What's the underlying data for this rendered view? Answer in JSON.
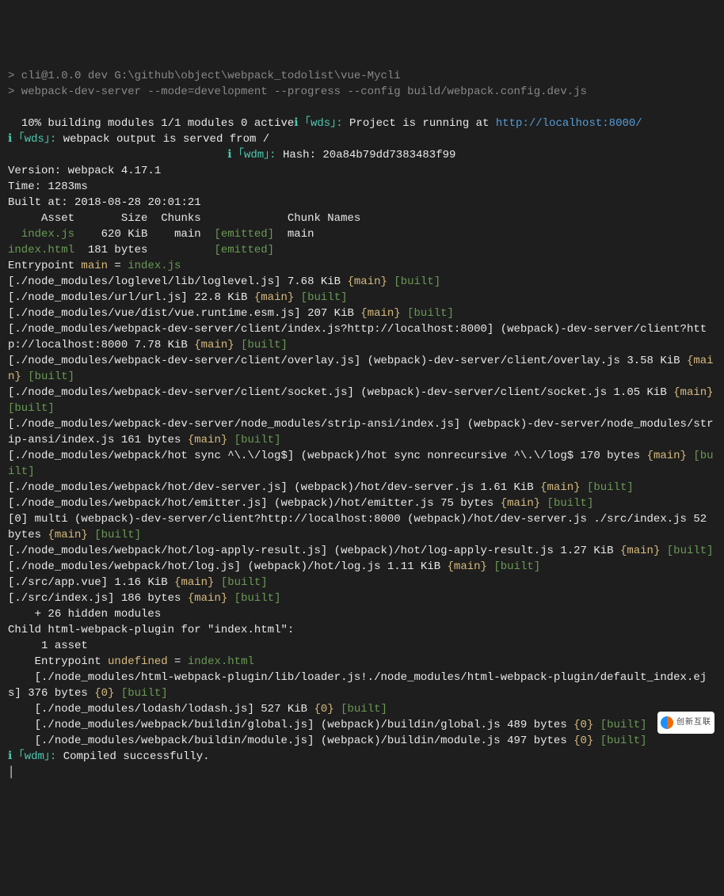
{
  "prompt1": "> cli@1.0.0 dev G:\\github\\object\\webpack_todolist\\vue-Mycli",
  "prompt2": "> webpack-dev-server --mode=development --progress --config build/webpack.config.dev.js",
  "progress": "  10% building modules 1/1 modules 0 active",
  "wds_tag": "ℹ ｢wds｣:",
  "running_at": " Project is running at ",
  "url": "http://localhost:8000/",
  "served_from": " webpack output is served from ",
  "slash": "/",
  "wdm_tag": "ℹ ｢wdm｣:",
  "hash": " Hash: 20a84b79dd7383483f99",
  "version_label": "Version:",
  "version_value": " webpack 4.17.1",
  "time_label": "Time:",
  "time_value": " 1283ms",
  "built_label": "Built at:",
  "built_value": " 2018-08-28 20:01:21",
  "header_row": "     Asset       Size  Chunks             Chunk Names",
  "row1_asset": "  index.js",
  "row1_size": "    620 KiB    ",
  "row1_chunk": "main",
  "row1_emit": "  [emitted]  ",
  "row1_name": "main",
  "row2_asset": "index.html",
  "row2_size": "  181 bytes          ",
  "row2_emit": "[emitted]",
  "entry_label": "Entrypoint ",
  "entry_main": "main",
  "entry_eq": " = ",
  "entry_file": "index.js",
  "lines": [
    {
      "p": "[./node_modules/loglevel/lib/loglevel.js]",
      "s": " 7.68 KiB ",
      "c": "{main}",
      "b": " [built]"
    },
    {
      "p": "[./node_modules/url/url.js]",
      "s": " 22.8 KiB ",
      "c": "{main}",
      "b": " [built]"
    },
    {
      "p": "[./node_modules/vue/dist/vue.runtime.esm.js]",
      "s": " 207 KiB ",
      "c": "{main}",
      "b": " [built]"
    },
    {
      "p": "[./node_modules/webpack-dev-server/client/index.js?http://localhost:8000]",
      "s": " (webpack)-dev-server/client?http://localhost:8000 7.78 KiB ",
      "c": "{main}",
      "b": " [built]"
    },
    {
      "p": "[./node_modules/webpack-dev-server/client/overlay.js]",
      "s": " (webpack)-dev-server/client/overlay.js 3.58 KiB ",
      "c": "{main}",
      "b": " [built]"
    },
    {
      "p": "[./node_modules/webpack-dev-server/client/socket.js]",
      "s": " (webpack)-dev-server/client/socket.js 1.05 KiB ",
      "c": "{main}",
      "b": " [built]"
    },
    {
      "p": "[./node_modules/webpack-dev-server/node_modules/strip-ansi/index.js]",
      "s": " (webpack)-dev-server/node_modules/strip-ansi/index.js 161 bytes ",
      "c": "{main}",
      "b": " [built]"
    },
    {
      "p": "[./node_modules/webpack/hot sync ^\\.\\/log$]",
      "s": " (webpack)/hot sync nonrecursive ^\\.\\/log$ 170 bytes ",
      "c": "{main}",
      "b": " [built]"
    },
    {
      "p": "[./node_modules/webpack/hot/dev-server.js]",
      "s": " (webpack)/hot/dev-server.js 1.61 KiB ",
      "c": "{main}",
      "b": " [built]"
    },
    {
      "p": "[./node_modules/webpack/hot/emitter.js]",
      "s": " (webpack)/hot/emitter.js 75 bytes ",
      "c": "{main}",
      "b": " [built]"
    },
    {
      "p": "[0] ",
      "pb": "multi (webpack)-dev-server/client?http://localhost:8000 (webpack)/hot/dev-server.js ./src/index.js",
      "s": " 52 bytes ",
      "c": "{main}",
      "b": " [built]"
    },
    {
      "p": "[./node_modules/webpack/hot/log-apply-result.js]",
      "s": " (webpack)/hot/log-apply-result.js 1.27 KiB ",
      "c": "{main}",
      "b": " [built]"
    },
    {
      "p": "[./node_modules/webpack/hot/log.js]",
      "s": " (webpack)/hot/log.js 1.11 KiB ",
      "c": "{main}",
      "b": " [built]"
    },
    {
      "p": "[./src/app.vue]",
      "s": " 1.16 KiB ",
      "c": "{main}",
      "b": " [built]"
    },
    {
      "p": "[./src/index.js]",
      "s": " 186 bytes ",
      "c": "{main}",
      "b": " [built]"
    }
  ],
  "hidden": "    + 26 hidden modules",
  "child_label": "Child ",
  "child_name": "html-webpack-plugin for \"index.html\"",
  "child_colon": ":",
  "child_asset": "     1 asset",
  "child_entry_label": "    Entrypoint ",
  "child_entry_name": "undefined",
  "child_entry_eq": " = ",
  "child_entry_file": "index.html",
  "child_lines": [
    {
      "p": "    [./node_modules/html-webpack-plugin/lib/loader.js!./node_modules/html-webpack-plugin/default_index.ejs]",
      "s": " 376 bytes ",
      "c": "{0}",
      "b": " [built]"
    },
    {
      "p": "    [./node_modules/lodash/lodash.js]",
      "s": " 527 KiB ",
      "c": "{0}",
      "b": " [built]"
    },
    {
      "p": "    [./node_modules/webpack/buildin/global.js]",
      "s": " (webpack)/buildin/global.js 489 bytes ",
      "c": "{0}",
      "b": " [built]"
    },
    {
      "p": "    [./node_modules/webpack/buildin/module.js]",
      "s": " (webpack)/buildin/module.js 497 bytes ",
      "c": "{0}",
      "b": " [built]"
    }
  ],
  "compiled": " Compiled successfully.",
  "cursor": "│",
  "logo_text": "创新互联"
}
